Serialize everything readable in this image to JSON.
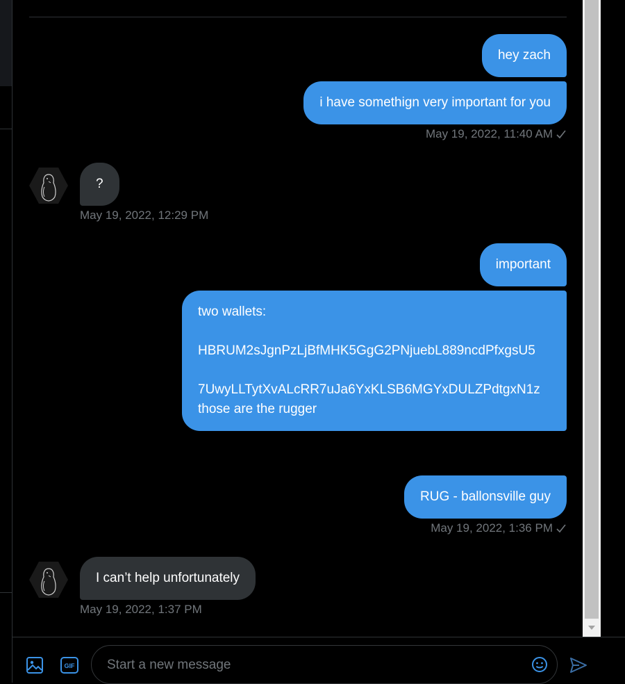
{
  "colors": {
    "accent": "#3b93e7",
    "incoming_bubble": "#2f3336",
    "timestamp": "#71767b",
    "background": "#000000"
  },
  "messages": [
    {
      "direction": "out",
      "text": "hey zach"
    },
    {
      "direction": "out",
      "text": "i have somethign very important for you"
    },
    {
      "direction": "out",
      "timestamp": "May 19, 2022, 11:40 AM",
      "status_icon": "check-icon"
    },
    {
      "direction": "in",
      "text": "?"
    },
    {
      "direction": "in",
      "timestamp": "May 19, 2022, 12:29 PM"
    },
    {
      "direction": "out",
      "text": "important"
    },
    {
      "direction": "out",
      "text": "two wallets:\n\nHBRUM2sJgnPzLjBfMHK5GgG2PNjuebL889ncdPfxgsU5\n\n7UwyLLTytXvALcRR7uJa6YxKLSB6MGYxDULZPdtgxN1z\nthose are the rugger"
    },
    {
      "direction": "out",
      "text": "RUG - ballonsville guy"
    },
    {
      "direction": "out",
      "timestamp": "May 19, 2022, 1:36 PM",
      "status_icon": "check-icon"
    },
    {
      "direction": "in",
      "text": "I can’t help unfortunately"
    },
    {
      "direction": "in",
      "timestamp": "May 19, 2022, 1:37 PM"
    }
  ],
  "composer": {
    "placeholder": "Start a new message",
    "media_icon": "image-icon",
    "gif_icon": "gif-icon",
    "gif_label": "GIF",
    "emoji_icon": "emoji-icon",
    "send_icon": "send-icon"
  },
  "avatar_icon": "penguin-avatar"
}
